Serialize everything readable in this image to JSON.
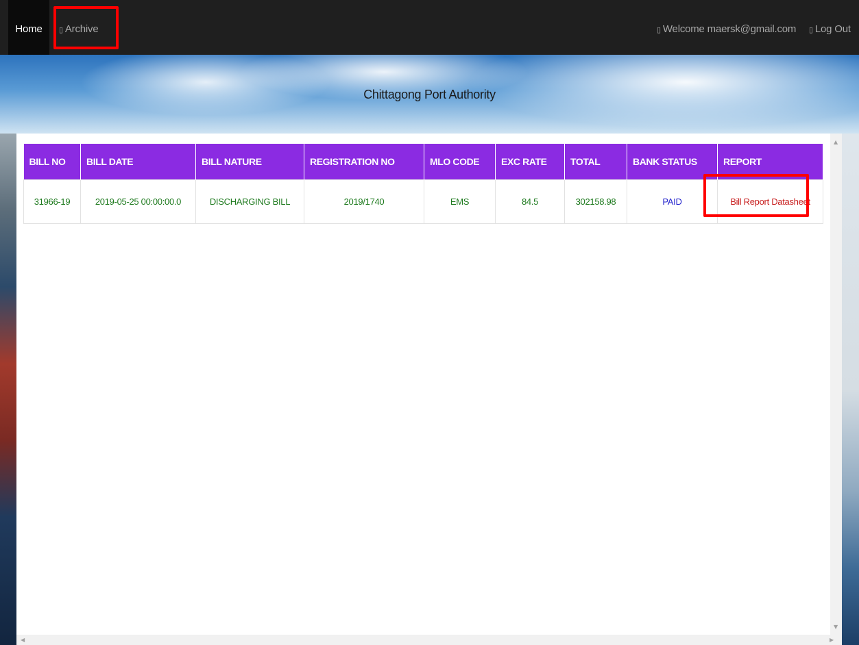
{
  "nav": {
    "home_label": "Home",
    "archive_label": "Archive",
    "welcome_label": "Welcome maersk@gmail.com",
    "logout_label": "Log Out",
    "glyph": "▯"
  },
  "banner": {
    "title": "Chittagong Port Authority"
  },
  "table": {
    "headers": [
      "BILL NO",
      "BILL DATE",
      "BILL NATURE",
      "REGISTRATION NO",
      "MLO CODE",
      "EXC RATE",
      "TOTAL",
      "BANK STATUS",
      "REPORT"
    ],
    "rows": [
      {
        "bill_no": "31966-19",
        "bill_date": "2019-05-25 00:00:00.0",
        "bill_nature": "DISCHARGING BILL",
        "registration_no": "2019/1740",
        "mlo_code": "EMS",
        "exc_rate": "84.5",
        "total": "302158.98",
        "bank_status": "PAID",
        "report": "Bill Report Datasheet"
      }
    ]
  },
  "colors": {
    "navbar": "#1f1f1f",
    "table_header": "#8b2be2",
    "cell_text": "#1e7a1e",
    "status_text": "#2222cc",
    "report_text": "#c82020",
    "highlight": "#ff0000"
  }
}
